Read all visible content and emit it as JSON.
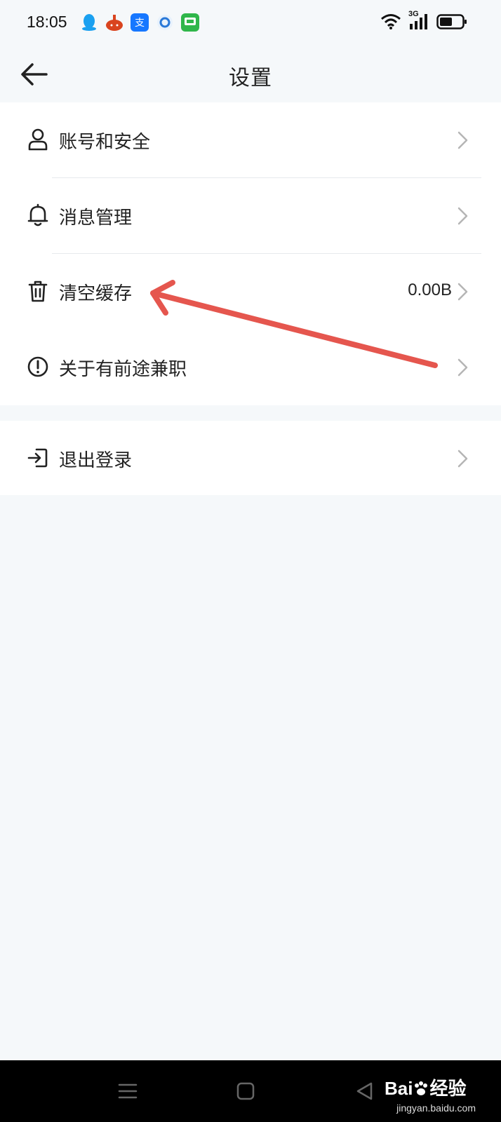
{
  "status_bar": {
    "time": "18:05",
    "network": "3G",
    "notifications": [
      "qq-icon",
      "taobao-icon",
      "alipay-icon",
      "browser-icon",
      "message-icon"
    ]
  },
  "header": {
    "title": "设置"
  },
  "settings": {
    "group1": [
      {
        "label": "账号和安全",
        "icon": "user-icon"
      },
      {
        "label": "消息管理",
        "icon": "bell-icon"
      },
      {
        "label": "清空缓存",
        "icon": "trash-icon",
        "value": "0.00B"
      },
      {
        "label": "关于有前途兼职",
        "icon": "info-icon"
      }
    ],
    "group2": [
      {
        "label": "退出登录",
        "icon": "logout-icon"
      }
    ]
  },
  "watermark": {
    "brand": "Bai",
    "brand2": "经验",
    "url": "jingyan.baidu.com"
  },
  "colors": {
    "background": "#f5f8fa",
    "card": "#ffffff",
    "annotation": "#e5564e"
  }
}
